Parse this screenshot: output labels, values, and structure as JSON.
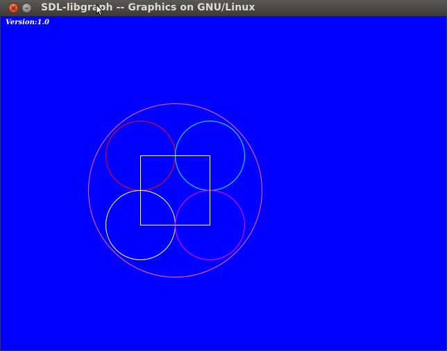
{
  "window": {
    "title": "SDL-libgraph -- Graphics on GNU/Linux",
    "close_glyph": "×",
    "minimize_glyph": "–",
    "background_color": "#0000ff"
  },
  "canvas": {
    "version_text": "Version:1.0",
    "shape_colors": {
      "outer_circle": "#ff66aa",
      "top_left_circle": "#ff0000",
      "top_right_circle": "#00ffff",
      "bottom_left_circle": "#ffffff",
      "bottom_right_circle": "#ff00ff",
      "square": "#ffffff"
    }
  }
}
